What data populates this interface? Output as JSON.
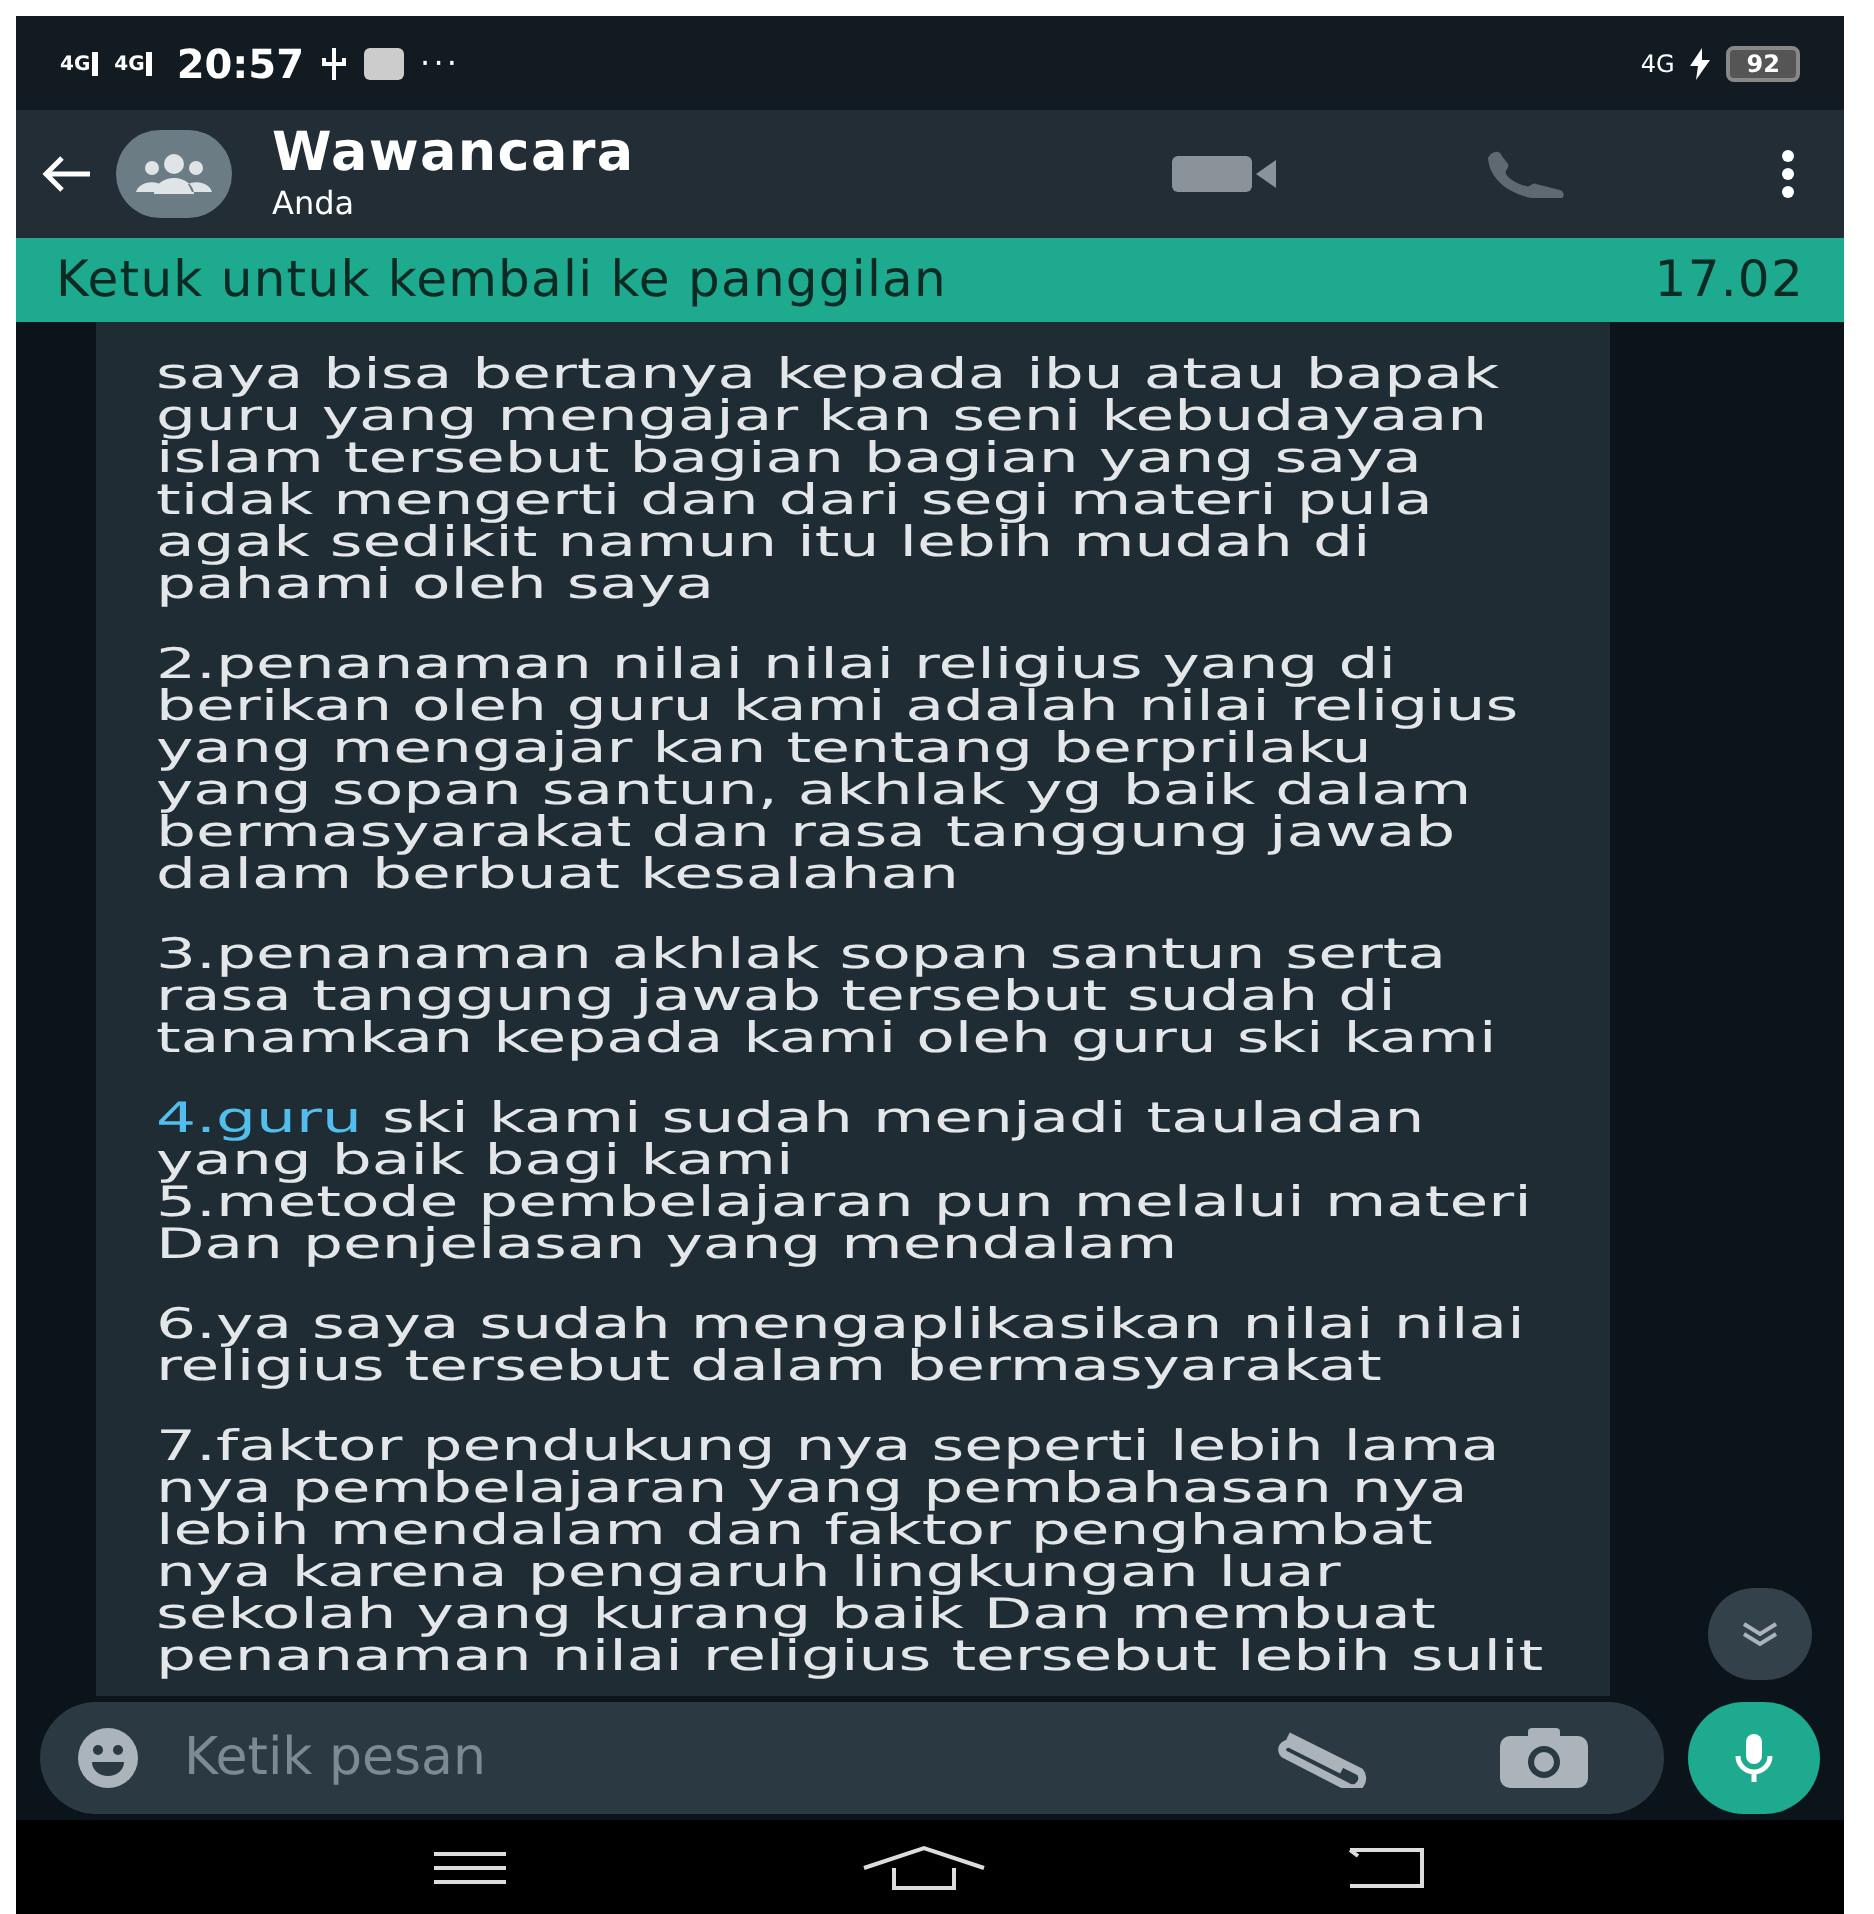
{
  "status_bar": {
    "signal_1": "4G",
    "signal_2": "4G",
    "time": "20:57",
    "more": "···",
    "network": "4G",
    "battery": "92"
  },
  "header": {
    "title": "Wawancara",
    "subtitle": "Anda"
  },
  "call_banner": {
    "text": "Ketuk untuk kembali ke panggilan",
    "duration": "17.02"
  },
  "message": {
    "paragraphs": [
      {
        "text": "saya bisa bertanya kepada ibu atau bapak\nguru yang mengajar kan seni kebudayaan\nislam tersebut bagian bagian yang saya\ntidak mengerti dan dari segi materi pula\nagak sedikit namun itu lebih mudah di\npahami oleh saya"
      },
      {
        "text": "2.penanaman nilai nilai religius yang di\nberikan oleh guru kami adalah nilai religius\nyang mengajar kan tentang berprilaku\nyang sopan santun, akhlak yg baik dalam\nbermasyarakat dan rasa tanggung jawab\ndalam berbuat kesalahan"
      },
      {
        "text": "3.penanaman akhlak sopan santun serta\nrasa tanggung jawab tersebut sudah di\ntanamkan kepada kami oleh guru ski kami"
      },
      {
        "link": "4.guru",
        "text": " ski kami sudah menjadi tauladan\nyang baik bagi kami\n5.metode pembelajaran pun melalui materi\nDan penjelasan yang mendalam"
      },
      {
        "text": "6.ya saya sudah mengaplikasikan nilai nilai\nreligius tersebut dalam bermasyarakat"
      },
      {
        "text": "7.faktor pendukung nya seperti lebih lama\nnya pembelajaran yang pembahasan nya\nlebih mendalam dan faktor penghambat\nnya karena pengaruh lingkungan luar\nsekolah yang kurang baik Dan membuat\npenanaman nilai religius tersebut lebih sulit"
      }
    ]
  },
  "composer": {
    "placeholder": "Ketik pesan"
  }
}
